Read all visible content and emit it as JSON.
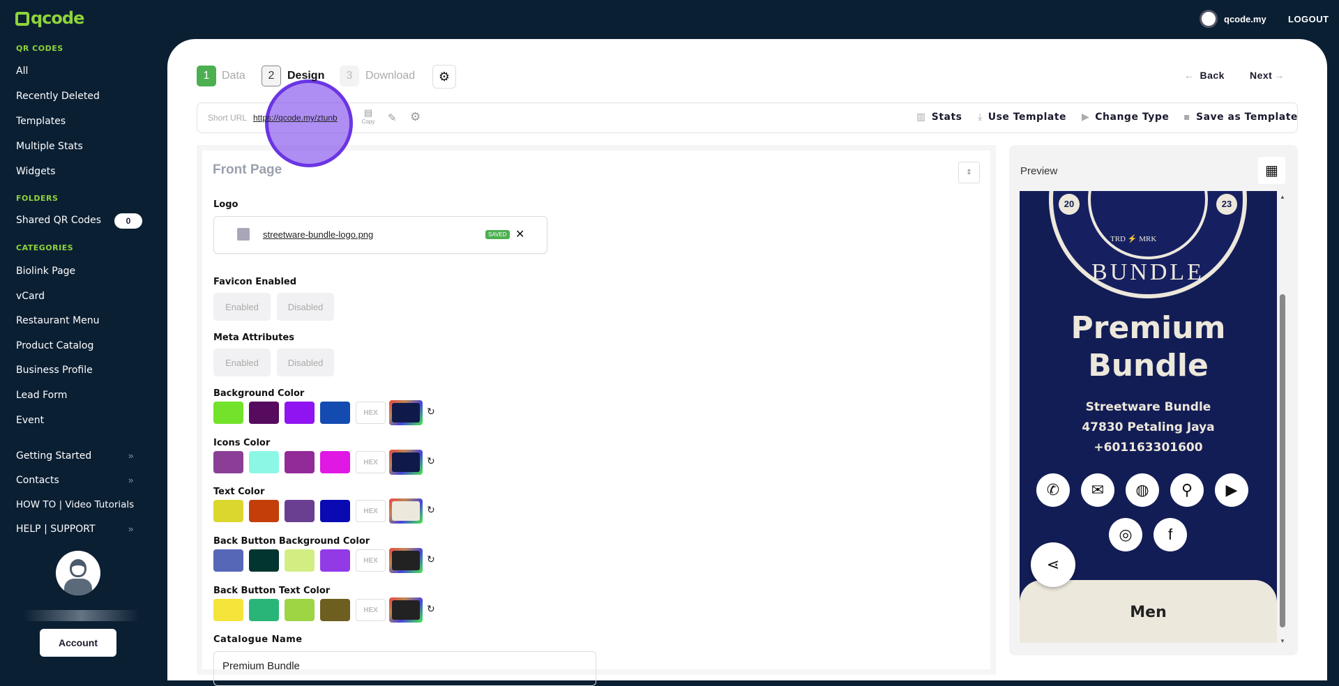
{
  "brand": {
    "logo": "qcode",
    "accent": "#8ed43a"
  },
  "topbar": {
    "username": "qcode.my",
    "logout": "LOGOUT"
  },
  "sidebar": {
    "qr_heading": "QR CODES",
    "qr_items": [
      "All",
      "Recently Deleted",
      "Templates",
      "Multiple Stats",
      "Widgets"
    ],
    "folders_heading": "FOLDERS",
    "shared": "Shared QR Codes",
    "shared_count": "0",
    "categories_heading": "CATEGORIES",
    "categories": [
      "Biolink Page",
      "vCard",
      "Restaurant Menu",
      "Product Catalog",
      "Business Profile",
      "Lead Form",
      "Event"
    ],
    "extra": [
      "Getting Started",
      "Contacts",
      "HOW TO | Video Tutorials",
      "HELP | SUPPORT"
    ],
    "account": "Account"
  },
  "steps": [
    {
      "n": "1",
      "label": "Data"
    },
    {
      "n": "2",
      "label": "Design"
    },
    {
      "n": "3",
      "label": "Download"
    }
  ],
  "nav": {
    "back": "Back",
    "next": "Next"
  },
  "toolbar": {
    "short_url_label": "Short URL",
    "short_url": "https://qcode.my/ztunb",
    "copy": "Copy",
    "stats": "Stats",
    "use_template": "Use Template",
    "change_type": "Change Type",
    "save_template": "Save as Template"
  },
  "form": {
    "section": "Front Page",
    "logo_label": "Logo",
    "logo_file": "streetware-bundle-logo.png",
    "saved": "SAVED",
    "favicon_label": "Favicon Enabled",
    "meta_label": "Meta Attributes",
    "enabled": "Enabled",
    "disabled": "Disabled",
    "hex": "HEX",
    "colors": [
      {
        "label": "Background Color",
        "swatches": [
          "#72e22a",
          "#560b5e",
          "#9014f2",
          "#134bb0"
        ],
        "current": "#0f1a4a"
      },
      {
        "label": "Icons Color",
        "swatches": [
          "#8a3e96",
          "#8cf7e5",
          "#922a98",
          "#e018e4"
        ],
        "current": "#0f1a4a"
      },
      {
        "label": "Text Color",
        "swatches": [
          "#dcd72e",
          "#c43e0a",
          "#6a3f92",
          "#0a0ab2"
        ],
        "current": "#ede8dc"
      },
      {
        "label": "Back Button Background Color",
        "swatches": [
          "#5767b8",
          "#033530",
          "#d2ee83",
          "#923ae6"
        ],
        "current": "#222222"
      },
      {
        "label": "Back Button Text Color",
        "swatches": [
          "#f5e43a",
          "#2ab578",
          "#9dd545",
          "#6e5e20"
        ],
        "current": "#222222"
      }
    ],
    "catalogue_label": "Catalogue Name",
    "catalogue_value": "Premium Bundle"
  },
  "preview": {
    "label": "Preview",
    "logo_text": [
      "20",
      "23",
      "TRD",
      "MRK",
      "BUNDLE"
    ],
    "title_lines": [
      "Premium",
      "Bundle"
    ],
    "lines": [
      "Streetware Bundle",
      "47830 Petaling Jaya",
      "+601163301600"
    ],
    "card": "Men",
    "bg": "#131d55",
    "text": "#ede8dc"
  }
}
